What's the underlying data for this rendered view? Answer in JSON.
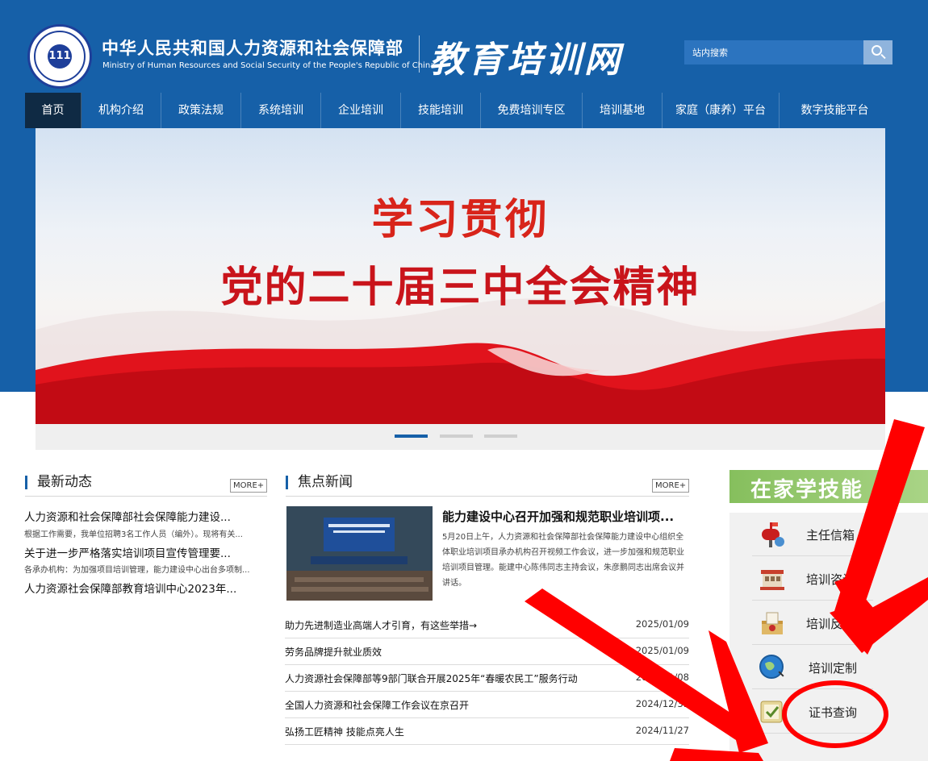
{
  "header": {
    "org_cn": "中华人民共和国人力资源和社会保障部",
    "org_en": "Ministry of Human Resources and Social Security of the People's Republic of China",
    "site_name": "教育培训网"
  },
  "search": {
    "placeholder": "站内搜索"
  },
  "nav": {
    "items": [
      {
        "label": "首页"
      },
      {
        "label": "机构介绍"
      },
      {
        "label": "政策法规"
      },
      {
        "label": "系统培训"
      },
      {
        "label": "企业培训"
      },
      {
        "label": "技能培训"
      },
      {
        "label": "免费培训专区"
      },
      {
        "label": "培训基地"
      },
      {
        "label": "家庭（康养）平台"
      },
      {
        "label": "数字技能平台"
      }
    ]
  },
  "banner": {
    "line1": "学习贯彻",
    "line2": "党的二十届三中全会精神",
    "slide_count": 3,
    "active_slide": 1
  },
  "latest": {
    "title": "最新动态",
    "more": "MORE+",
    "items": [
      {
        "title": "人力资源和社会保障部社会保障能力建设...",
        "desc": "根据工作需要，我单位招聘3名工作人员（编外）。现将有关..."
      },
      {
        "title": "关于进一步严格落实培训项目宣传管理要...",
        "desc": "各承办机构：为加强项目培训管理，能力建设中心出台多项制..."
      },
      {
        "title": "人力资源社会保障部教育培训中心2023年...",
        "desc": ""
      }
    ]
  },
  "focus": {
    "title": "焦点新闻",
    "more": "MORE+",
    "lead": {
      "title": "能力建设中心召开加强和规范职业培训项...",
      "desc": "5月20日上午，人力资源和社会保障部社会保障能力建设中心组织全体职业培训项目承办机构召开视频工作会议，进一步加强和规范职业培训项目管理。能建中心陈伟同志主持会议，朱彦鹏同志出席会议并讲话。"
    },
    "items": [
      {
        "title": "助力先进制造业高端人才引育，有这些举措→",
        "date": "2025/01/09"
      },
      {
        "title": "劳务品牌提升就业质效",
        "date": "2025/01/09"
      },
      {
        "title": "人力资源社会保障部等9部门联合开展2025年“春暖农民工”服务行动",
        "date": "2025/01/08"
      },
      {
        "title": "全国人力资源和社会保障工作会议在京召开",
        "date": "2024/12/31"
      },
      {
        "title": "弘扬工匠精神 技能点亮人生",
        "date": "2024/11/27"
      }
    ]
  },
  "sidebar": {
    "banner": "在家学技能",
    "items": [
      {
        "label": "主任信箱",
        "icon": "mailbox-icon"
      },
      {
        "label": "培训咨询",
        "icon": "building-icon"
      },
      {
        "label": "培训反馈",
        "icon": "ballot-box-icon"
      },
      {
        "label": "培训定制",
        "icon": "globe-icon"
      },
      {
        "label": "证书查询",
        "icon": "certificate-icon"
      }
    ]
  },
  "colors": {
    "brand_blue": "#1660a8",
    "nav_active": "#0f2a44",
    "banner_red": "#d8241a",
    "annotation_red": "#ff0000",
    "sidebar_green": "#86bf5d"
  }
}
